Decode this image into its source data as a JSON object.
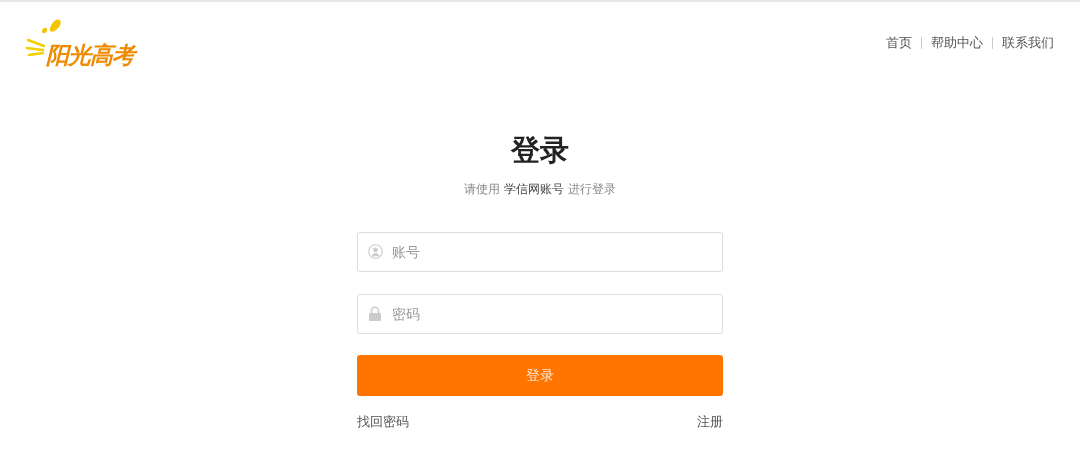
{
  "logo": {
    "text": "阳光高考"
  },
  "nav": [
    "首页",
    "帮助中心",
    "联系我们"
  ],
  "title": "登录",
  "subtitle": "请使用 **学信网账号** 进行登录",
  "fields": [
    {
      "kind": "user",
      "placeholder": "账号"
    },
    {
      "kind": "lock",
      "placeholder": "密码"
    }
  ],
  "submit": "登录",
  "links": {
    "forgot": "找回密码",
    "register": "注册"
  }
}
